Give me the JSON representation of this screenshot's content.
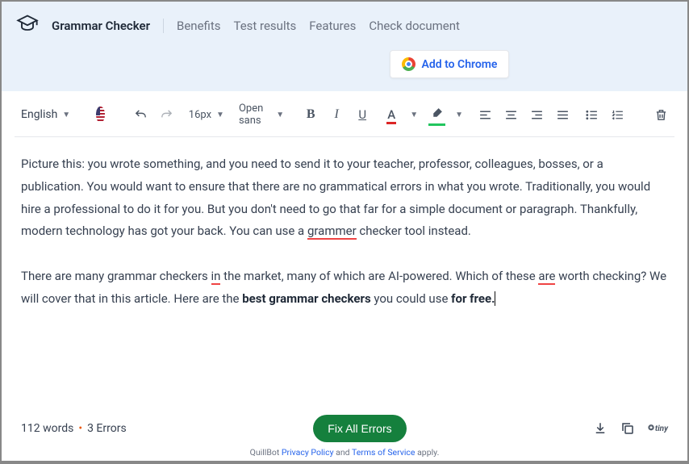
{
  "nav": {
    "items": [
      "Grammar Checker",
      "Benefits",
      "Test results",
      "Features",
      "Check document"
    ],
    "chrome_label": "Add to Chrome"
  },
  "toolbar": {
    "language": "English",
    "fontsize": "16px",
    "fontfamily": "Open sans"
  },
  "content": {
    "p1_a": "Picture this: you wrote something, and you need to send it to your teacher, professor, colleagues, bosses, or a publication. You would want to ensure that there are no grammatical errors in what you wrote. Traditionally, you would hire a professional to do it for you. But you don't need to go that far for a simple document or paragraph. Thankfully, modern technology has got your back. You can use a ",
    "p1_err": "grammer",
    "p1_b": " checker tool instead.",
    "p2_a": "There are many grammar checkers ",
    "p2_err1": "in",
    "p2_b": " the market, many of which are AI-powered. Which of these ",
    "p2_err2": "are",
    "p2_c": " worth checking? We will cover that in this article. Here are the ",
    "p2_bold1": "best grammar checkers",
    "p2_d": " you could use ",
    "p2_bold2": "for free.",
    "errors": [
      "grammer",
      "in",
      "are"
    ]
  },
  "footer": {
    "words": "112 words",
    "errors": "3 Errors",
    "fix_label": "Fix All Errors",
    "tiny": "tiny",
    "legal_prefix": "QuillBot ",
    "privacy": "Privacy Policy",
    "and": " and ",
    "tos": "Terms of Service",
    "apply": " apply."
  }
}
